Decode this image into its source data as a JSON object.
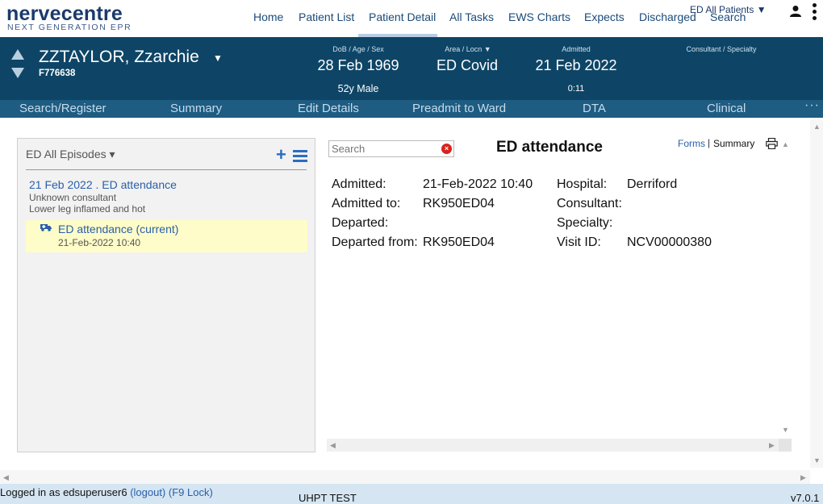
{
  "app": {
    "logo_main": "nervecentre",
    "logo_sub": "NEXT GENERATION EPR"
  },
  "nav": {
    "items": [
      {
        "label": "Home"
      },
      {
        "label": "Patient List"
      },
      {
        "label": "Patient Detail",
        "active": true
      },
      {
        "label": "All Tasks"
      },
      {
        "label": "EWS Charts"
      },
      {
        "label": "Expects"
      },
      {
        "label": "Discharged"
      },
      {
        "label": "Search"
      }
    ],
    "ward_select": "ED All Patients ▼"
  },
  "patient": {
    "name": "ZZTAYLOR, Zzarchie",
    "caret": "▼",
    "id": "F776638",
    "dob_label": "DoB / Age / Sex",
    "dob": "28 Feb 1969",
    "age_sex": "52y Male",
    "area_label": "Area / Locn ▼",
    "area": "ED Covid",
    "admitted_label": "Admitted",
    "admitted": "21 Feb 2022",
    "admitted_duration": "0:11",
    "consultant_label": "Consultant / Specialty"
  },
  "tabs": [
    {
      "label": "Search/Register"
    },
    {
      "label": "Summary"
    },
    {
      "label": "Edit Details"
    },
    {
      "label": "Preadmit to Ward"
    },
    {
      "label": "DTA"
    },
    {
      "label": "Clinical"
    }
  ],
  "tab_more": "···",
  "episodes": {
    "header": "ED All Episodes ▾",
    "add_label": "+",
    "entry": {
      "title": "21 Feb 2022 . ED attendance",
      "consultant": "Unknown consultant",
      "complaint": "Lower leg inflamed and hot"
    },
    "current": {
      "title": "ED attendance (current)",
      "date": "21-Feb-2022 10:40"
    }
  },
  "detail": {
    "search_placeholder": "Search",
    "search_clear": "×",
    "title": "ED attendance",
    "forms_link": "Forms",
    "separator": "|",
    "summary_link": "Summary",
    "fields_left": [
      {
        "label": "Admitted:",
        "value": "21-Feb-2022 10:40"
      },
      {
        "label": "Admitted to:",
        "value": "RK950ED04"
      },
      {
        "label": "Departed:",
        "value": ""
      },
      {
        "label": "Departed from:",
        "value": "RK950ED04"
      }
    ],
    "fields_right": [
      {
        "label": "Hospital:",
        "value": "Derriford"
      },
      {
        "label": "Consultant:",
        "value": ""
      },
      {
        "label": "Specialty:",
        "value": ""
      },
      {
        "label": "Visit ID:",
        "value": "NCV00000380"
      }
    ]
  },
  "footer": {
    "login_text": "Logged in as edsuperuser6",
    "logout_link": "(logout)",
    "lock_link": "(F9 Lock)",
    "environment": "UHPT TEST",
    "version": "v7.0.1"
  },
  "colors": {
    "banner": "#0e4566",
    "tabbar": "#1e5c82",
    "link": "#2a5fa8",
    "current_episode_bg": "#fefcc8",
    "footer_bg": "#d5e5f2"
  },
  "icons": [
    "person-icon",
    "kebab-menu-icon",
    "ambulance-icon",
    "print-icon",
    "hamburger-menu-icon",
    "plus-icon",
    "clear-search-icon"
  ]
}
